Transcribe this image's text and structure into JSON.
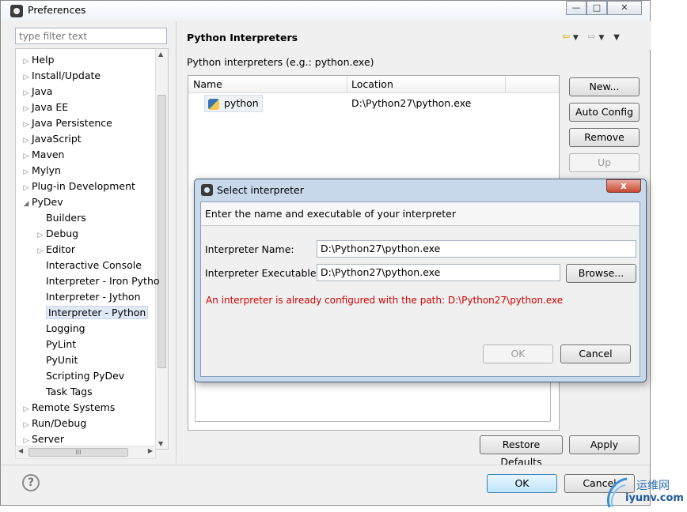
{
  "window": {
    "title": "Preferences",
    "controls": {
      "minimize": "—",
      "maximize": "□",
      "close": "✕"
    }
  },
  "sidebar": {
    "filter_placeholder": "type filter text",
    "items": [
      {
        "label": "Help",
        "expanded": false,
        "level": 0
      },
      {
        "label": "Install/Update",
        "expanded": false,
        "level": 0
      },
      {
        "label": "Java",
        "expanded": false,
        "level": 0
      },
      {
        "label": "Java EE",
        "expanded": false,
        "level": 0
      },
      {
        "label": "Java Persistence",
        "expanded": false,
        "level": 0
      },
      {
        "label": "JavaScript",
        "expanded": false,
        "level": 0
      },
      {
        "label": "Maven",
        "expanded": false,
        "level": 0
      },
      {
        "label": "Mylyn",
        "expanded": false,
        "level": 0
      },
      {
        "label": "Plug-in Development",
        "expanded": false,
        "level": 0
      },
      {
        "label": "PyDev",
        "expanded": true,
        "level": 0
      },
      {
        "label": "Builders",
        "level": 1
      },
      {
        "label": "Debug",
        "expanded": false,
        "level": 1
      },
      {
        "label": "Editor",
        "expanded": false,
        "level": 1
      },
      {
        "label": "Interactive Console",
        "level": 1
      },
      {
        "label": "Interpreter - Iron Pytho",
        "level": 1
      },
      {
        "label": "Interpreter - Jython",
        "level": 1
      },
      {
        "label": "Interpreter - Python",
        "level": 1,
        "selected": true
      },
      {
        "label": "Logging",
        "level": 1
      },
      {
        "label": "PyLint",
        "level": 1
      },
      {
        "label": "PyUnit",
        "level": 1
      },
      {
        "label": "Scripting PyDev",
        "level": 1
      },
      {
        "label": "Task Tags",
        "level": 1
      },
      {
        "label": "Remote Systems",
        "expanded": false,
        "level": 0
      },
      {
        "label": "Run/Debug",
        "expanded": false,
        "level": 0
      },
      {
        "label": "Server",
        "expanded": false,
        "level": 0
      }
    ],
    "hscroll_glyph": "III"
  },
  "page": {
    "title": "Python Interpreters",
    "subtitle": "Python interpreters (e.g.: python.exe)",
    "table": {
      "columns": [
        "Name",
        "Location"
      ],
      "rows": [
        {
          "name": "python",
          "location": "D:\\Python27\\python.exe"
        }
      ]
    },
    "buttons": {
      "new": "New...",
      "auto_config": "Auto Config",
      "remove": "Remove",
      "up": "Up"
    },
    "restore_defaults": "Restore Defaults",
    "apply": "Apply"
  },
  "footer": {
    "ok": "OK",
    "cancel": "Cancel",
    "help_glyph": "?"
  },
  "dialog": {
    "title": "Select interpreter",
    "close_glyph": "x",
    "message": "Enter the name and executable of your interpreter",
    "name_label": "Interpreter Name:",
    "name_value": "D:\\Python27\\python.exe",
    "exe_label": "Interpreter Executable:",
    "exe_value": "D:\\Python27\\python.exe",
    "browse": "Browse...",
    "error": "An interpreter is already configured with the path: D:\\Python27\\python.exe",
    "ok": "OK",
    "cancel": "Cancel"
  },
  "watermark": {
    "line1": "运维网",
    "line2": "iyunv.com"
  },
  "colors": {
    "error": "#d10000",
    "accent": "#3c7fb1"
  }
}
